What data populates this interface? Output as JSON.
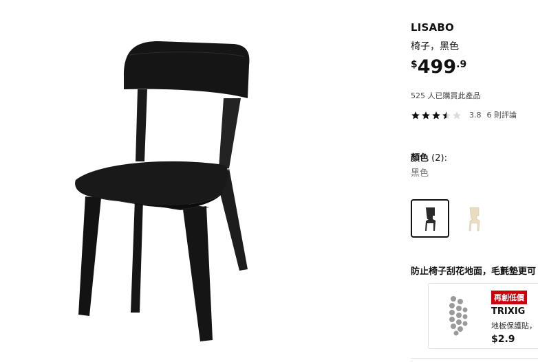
{
  "product": {
    "name": "LISABO",
    "description": "椅子，黑色",
    "price": {
      "currency": "$",
      "integer": "499",
      "decimal": ".9"
    },
    "purchased_text": "525 人已購買此產品",
    "rating": {
      "value": "3.8",
      "stars": 3.8,
      "reviews_text": "6 則評論"
    }
  },
  "color": {
    "label": "顏色",
    "count": "(2):",
    "selected_value": "黑色",
    "options": [
      {
        "name": "black-chair",
        "color": "#2a2a2a"
      },
      {
        "name": "ash-chair",
        "color": "#e9dcc3"
      }
    ]
  },
  "section": {
    "title": "防止椅子刮花地面，毛氈墊更可"
  },
  "promo": {
    "badge": "再創低價",
    "name": "TRIXIG",
    "description": "地板保護貼，",
    "price": "$2.9",
    "badge_color": "#cc0008"
  }
}
